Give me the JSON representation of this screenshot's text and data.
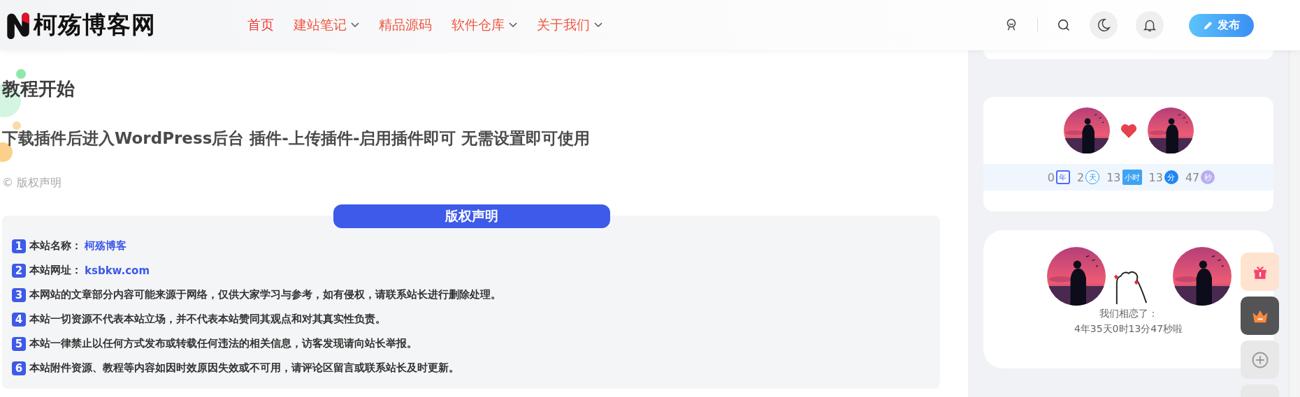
{
  "header": {
    "logo": "柯殇博客网",
    "nav": [
      {
        "label": "首页",
        "has_menu": false,
        "selected": true
      },
      {
        "label": "建站笔记",
        "has_menu": true,
        "selected": false
      },
      {
        "label": "精品源码",
        "has_menu": false,
        "selected": false
      },
      {
        "label": "软件仓库",
        "has_menu": true,
        "selected": false
      },
      {
        "label": "关于我们",
        "has_menu": true,
        "selected": false
      }
    ],
    "publish_button": "发布"
  },
  "article": {
    "heading": "教程开始",
    "subheading": "下载插件后进入WordPress后台 插件-上传插件-启用插件即可 无需设置即可使用",
    "copyright_link": "© 版权声明",
    "notice": {
      "title": "版权声明",
      "items": [
        {
          "number": "1",
          "label": "本站名称：",
          "value": "柯殇博客"
        },
        {
          "number": "2",
          "label": "本站网址：",
          "value": "ksbkw.com"
        },
        {
          "number": "3",
          "label": "本网站的文章部分内容可能来源于网络，仅供大家学习与参考，如有侵权，请联系站长进行删除处理。"
        },
        {
          "number": "4",
          "label": "本站一切资源不代表本站立场，并不代表本站赞同其观点和对其真实性负责。"
        },
        {
          "number": "5",
          "label": "本站一律禁止以任何方式发布或转载任何违法的相关信息，访客发现请向站长举报。"
        },
        {
          "number": "6",
          "label": "本站附件资源、教程等内容如因时效原因失效或不可用，请评论区留言或联系站长及时更新。"
        }
      ]
    }
  },
  "sidebar": {
    "timer": [
      {
        "value": "0",
        "unit": "年",
        "kind": "calendar",
        "color": "#4a6cf7"
      },
      {
        "value": "2",
        "unit": "天",
        "kind": "ring",
        "color": "#2a9cf5"
      },
      {
        "value": "13",
        "unit": "小时",
        "kind": "block",
        "color": "#3ea3f2"
      },
      {
        "value": "13",
        "unit": "分",
        "kind": "disc",
        "color": "#1d86f4"
      },
      {
        "value": "47",
        "unit": "秒",
        "kind": "disc",
        "color": "#b7aef0"
      }
    ],
    "love": {
      "caption": "我们相恋了：",
      "duration": "4年35天0时13分47秒啦"
    }
  }
}
